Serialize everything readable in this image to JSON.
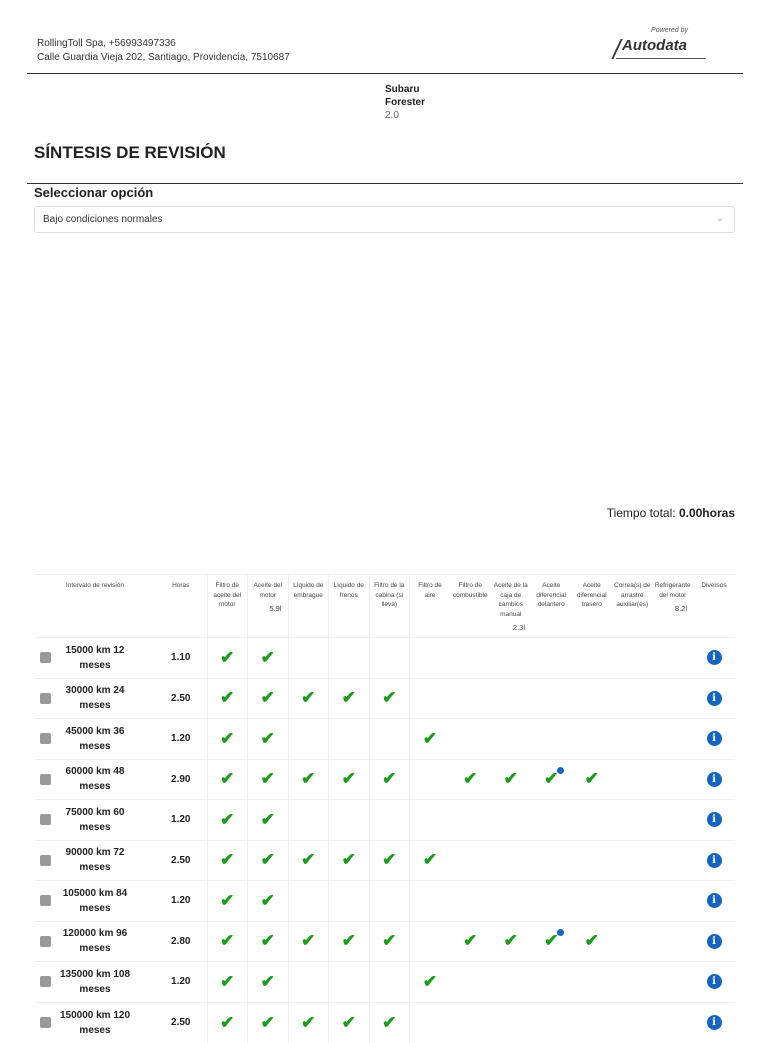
{
  "header": {
    "company_line": "RollingToll Spa, +56993497336",
    "address_line": "Calle Guardia Vieja 202, Santiago, Providencia, 7510687",
    "logo_powered": "Powered by",
    "logo_name": "Autodata"
  },
  "vehicle": {
    "make": "Subaru",
    "model": "Forester",
    "engine": "2.0"
  },
  "page_title": "SÍNTESIS DE REVISIÓN",
  "select": {
    "label": "Seleccionar opción",
    "value": "Bajo condiciones normales"
  },
  "total": {
    "label": "Tiempo total: ",
    "value": "0.00horas"
  },
  "table": {
    "headers": [
      {
        "label": "Intervalo de revisión"
      },
      {
        "label": "Horas"
      },
      {
        "label": "Filtro de aceite del motor"
      },
      {
        "label": "Aceite del motor",
        "qty": "5.9l"
      },
      {
        "label": "Líquido de embrague"
      },
      {
        "label": "Líquido de frenos"
      },
      {
        "label": "Filtro de la cabina (si lleva)"
      },
      {
        "label": "Filtro de aire"
      },
      {
        "label": "Filtro de combustible"
      },
      {
        "label": "Aceite de la caja de cambios manual",
        "qty": "2.3l"
      },
      {
        "label": "Aceite diferencial delantero"
      },
      {
        "label": "Aceite diferencial trasero"
      },
      {
        "label": "Correa(s) de arrastre auxiliar(es)"
      },
      {
        "label": "Refrigerante del motor",
        "qty": "8.2l"
      },
      {
        "label": "Diversos"
      }
    ],
    "rows": [
      {
        "interval": "15000 km 12 meses",
        "hours": "1.10",
        "checks": [
          0,
          1
        ]
      },
      {
        "interval": "30000 km 24 meses",
        "hours": "2.50",
        "checks": [
          0,
          1,
          2,
          3,
          4
        ]
      },
      {
        "interval": "45000 km 36 meses",
        "hours": "1.20",
        "checks": [
          0,
          1,
          5
        ]
      },
      {
        "interval": "60000 km 48 meses",
        "hours": "2.90",
        "checks": [
          0,
          1,
          2,
          3,
          4,
          6,
          7,
          8,
          9
        ],
        "dot": 8
      },
      {
        "interval": "75000 km 60 meses",
        "hours": "1.20",
        "checks": [
          0,
          1
        ]
      },
      {
        "interval": "90000 km 72 meses",
        "hours": "2.50",
        "checks": [
          0,
          1,
          2,
          3,
          4,
          5
        ]
      },
      {
        "interval": "105000 km 84 meses",
        "hours": "1.20",
        "checks": [
          0,
          1
        ]
      },
      {
        "interval": "120000 km 96 meses",
        "hours": "2.80",
        "checks": [
          0,
          1,
          2,
          3,
          4,
          6,
          7,
          8,
          9
        ],
        "dot": 8
      },
      {
        "interval": "135000 km 108 meses",
        "hours": "1.20",
        "checks": [
          0,
          1,
          5
        ]
      },
      {
        "interval": "150000 km 120 meses",
        "hours": "2.50",
        "checks": [
          0,
          1,
          2,
          3,
          4
        ]
      }
    ]
  },
  "colors": {
    "check": "#1a9b1a",
    "info": "#1565c0"
  }
}
